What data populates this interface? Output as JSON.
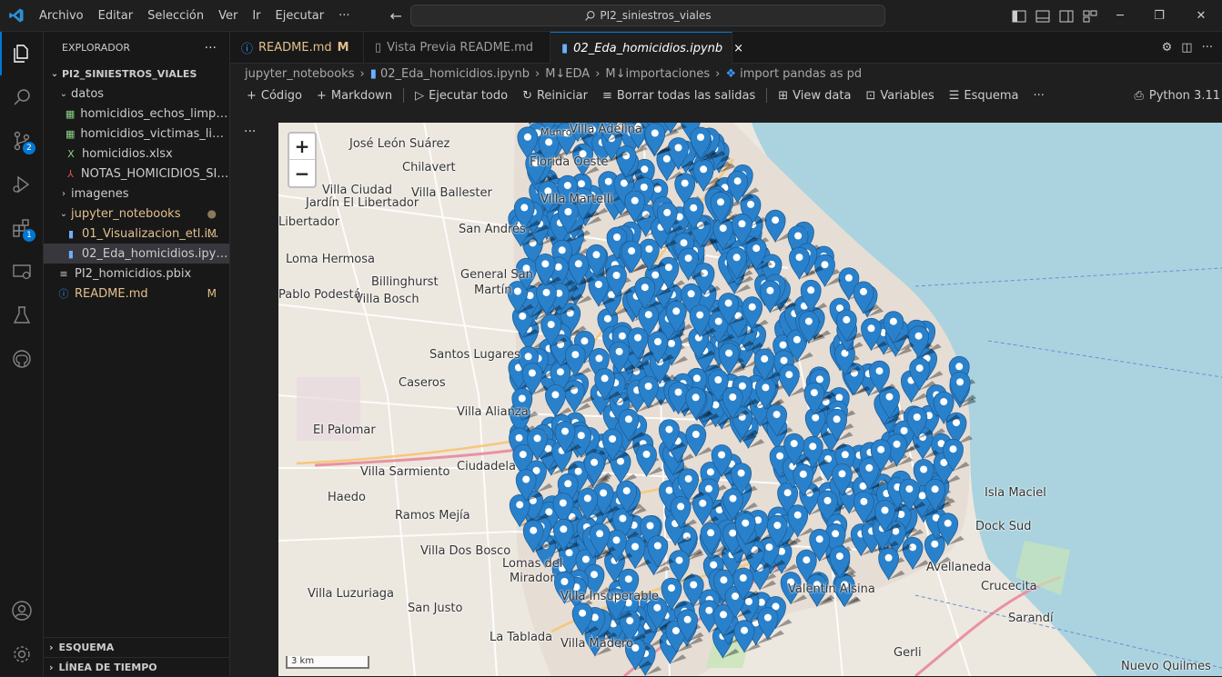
{
  "titlebar": {
    "menu": [
      "Archivo",
      "Editar",
      "Selección",
      "Ver",
      "Ir",
      "Ejecutar",
      "···"
    ],
    "search": "PI2_siniestros_viales"
  },
  "activity": {
    "scm_badge": "2",
    "extensions_badge": "1"
  },
  "sidebar": {
    "title": "EXPLORADOR",
    "root": "PI2_SINIESTROS_VIALES",
    "items": [
      {
        "label": "datos",
        "depth": 1,
        "kind": "folder-open",
        "status": ""
      },
      {
        "label": "homicidios_echos_limpio.c...",
        "depth": 2,
        "kind": "csv",
        "status": ""
      },
      {
        "label": "homicidios_victimas_limpi...",
        "depth": 2,
        "kind": "csv",
        "status": ""
      },
      {
        "label": "homicidios.xlsx",
        "depth": 2,
        "kind": "xlsx",
        "status": ""
      },
      {
        "label": "NOTAS_HOMICIDIOS_SINI...",
        "depth": 2,
        "kind": "pdf",
        "status": ""
      },
      {
        "label": "imagenes",
        "depth": 1,
        "kind": "folder-closed",
        "status": ""
      },
      {
        "label": "jupyter_notebooks",
        "depth": 1,
        "kind": "folder-open",
        "status": "●"
      },
      {
        "label": "01_Visualizacion_etl.i...",
        "depth": 2,
        "kind": "notebook",
        "status": "M"
      },
      {
        "label": "02_Eda_homicidios.ipynb",
        "depth": 2,
        "kind": "notebook",
        "status": ""
      },
      {
        "label": "PI2_homicidios.pbix",
        "depth": 1,
        "kind": "file",
        "status": ""
      },
      {
        "label": "README.md",
        "depth": 1,
        "kind": "info",
        "status": "M"
      }
    ],
    "outline": "ESQUEMA",
    "timeline": "LÍNEA DE TIEMPO"
  },
  "tabs": [
    {
      "label": "README.md",
      "mod": "M"
    },
    {
      "label": "Vista Previa README.md",
      "mod": ""
    },
    {
      "label": "02_Eda_homicidios.ipynb",
      "mod": "×"
    }
  ],
  "breadcrumbs": [
    "jupyter_notebooks",
    "02_Eda_homicidios.ipynb",
    "M↓EDA",
    "M↓importaciones",
    "import pandas as pd"
  ],
  "toolbar": {
    "code": "Código",
    "markdown": "Markdown",
    "run_all": "Ejecutar todo",
    "restart": "Reiniciar",
    "clear": "Borrar todas las salidas",
    "view_data": "View data",
    "variables": "Variables",
    "outline": "Esquema",
    "more": "···",
    "kernel": "Python 3.11"
  },
  "map": {
    "zoom_in": "+",
    "zoom_out": "−",
    "scale": "3 km",
    "places": [
      {
        "name": "José León Suárez"
      },
      {
        "name": "Chilavert"
      },
      {
        "name": "Villa Ballester"
      },
      {
        "name": "Villa Ciudad"
      },
      {
        "name": "Jardín El Libertador"
      },
      {
        "name": "Libertador"
      },
      {
        "name": "San Andrés"
      },
      {
        "name": "Loma Hermosa"
      },
      {
        "name": "General San"
      },
      {
        "name": "Martín"
      },
      {
        "name": "Billinghurst"
      },
      {
        "name": "Pablo Podestá"
      },
      {
        "name": "Villa Bosch"
      },
      {
        "name": "Santos Lugares"
      },
      {
        "name": "Caseros"
      },
      {
        "name": "El Palomar"
      },
      {
        "name": "Villa Sarmiento"
      },
      {
        "name": "Ciudadela"
      },
      {
        "name": "Haedo"
      },
      {
        "name": "Ramos Mejía"
      },
      {
        "name": "Villa Dos Bosco"
      },
      {
        "name": "Lomas del"
      },
      {
        "name": "Mirador"
      },
      {
        "name": "Villa Luzuriaga"
      },
      {
        "name": "San Justo"
      },
      {
        "name": "La Tablada"
      },
      {
        "name": "Villa Madero"
      },
      {
        "name": "Valentín Alsina"
      },
      {
        "name": "Avellaneda"
      },
      {
        "name": "Dock Sud"
      },
      {
        "name": "Isla Maciel"
      },
      {
        "name": "Sarandí"
      },
      {
        "name": "Gerli"
      },
      {
        "name": "Crucecita"
      },
      {
        "name": "Nuevo Quilmes"
      },
      {
        "name": "Villa Alianza"
      },
      {
        "name": "Munro"
      },
      {
        "name": "Florida Oeste"
      },
      {
        "name": "Villa Martelli"
      },
      {
        "name": "Villa Adelina"
      },
      {
        "name": "Villa Insuperable"
      }
    ]
  }
}
